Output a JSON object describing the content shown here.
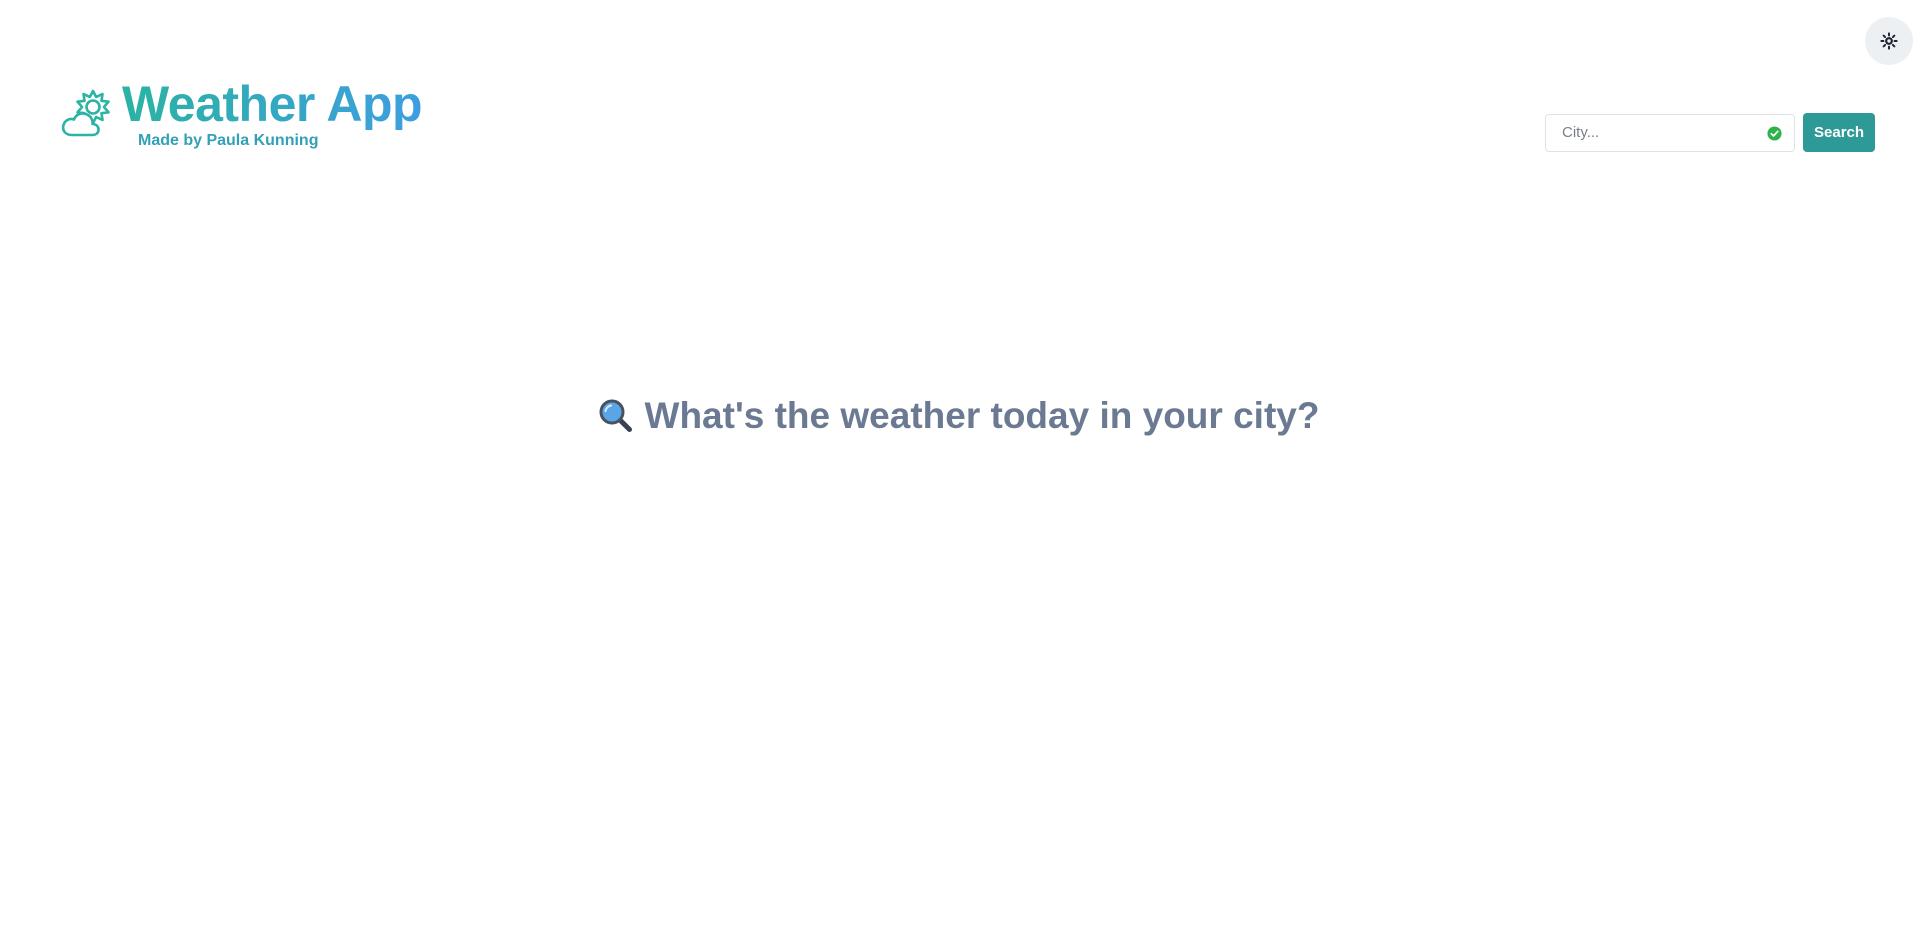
{
  "header": {
    "title": "Weather App",
    "subtitle": "Made by Paula Kunning",
    "logo_icon": "cloud-sun-icon",
    "theme_toggle_icon": "sun-icon"
  },
  "search": {
    "placeholder": "City...",
    "value": "",
    "button_label": "Search",
    "valid_icon": "check-circle-icon"
  },
  "main": {
    "prompt_icon": "magnifying-glass-icon",
    "prompt_text": "What's the weather today in your city?"
  },
  "colors": {
    "accent": "#2e9a97",
    "title_gradient_start": "#2bb3a3",
    "title_gradient_end": "#3d9ee0",
    "prompt_text": "#6b7a92",
    "valid": "#2eb24a"
  }
}
